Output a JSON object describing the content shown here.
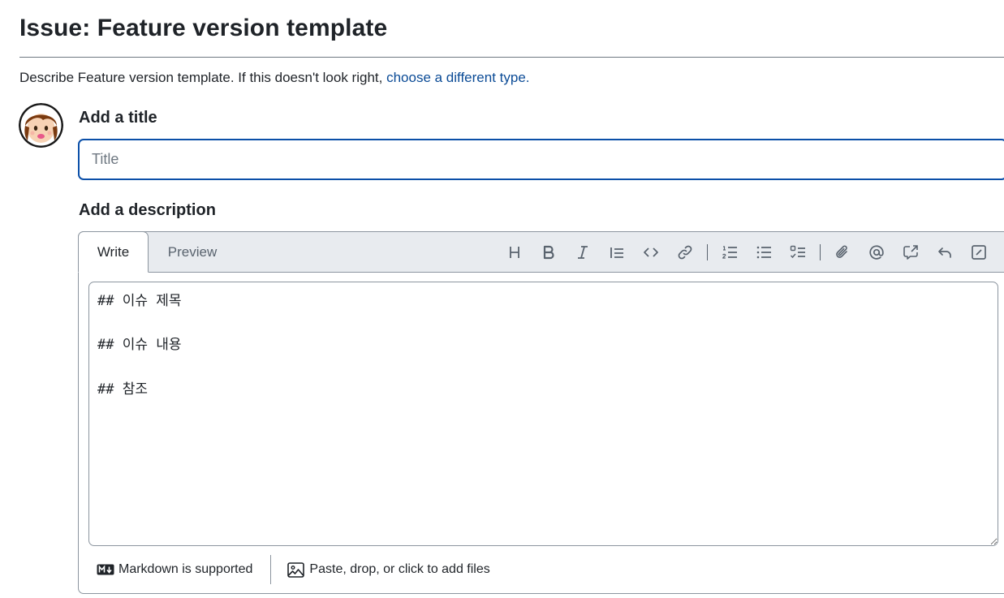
{
  "header": {
    "title": "Issue: Feature version template",
    "description_prefix": "Describe Feature version template. If this doesn't look right, ",
    "description_link": "choose a different type."
  },
  "title_field": {
    "label": "Add a title",
    "placeholder": "Title",
    "value": ""
  },
  "description_field": {
    "label": "Add a description",
    "tabs": [
      {
        "label": "Write",
        "active": true
      },
      {
        "label": "Preview",
        "active": false
      }
    ],
    "toolbar_icons": [
      "heading-icon",
      "bold-icon",
      "italic-icon",
      "quote-icon",
      "code-icon",
      "link-icon",
      "ordered-list-icon",
      "unordered-list-icon",
      "task-list-icon",
      "attach-icon",
      "mention-icon",
      "reference-icon",
      "undo-icon",
      "fullscreen-icon"
    ],
    "body": "## 이슈 제목\n\n## 이슈 내용\n\n## 참조",
    "footer": {
      "markdown_label": "Markdown is supported",
      "files_label": "Paste, drop, or click to add files"
    }
  },
  "colors": {
    "link": "#0b4b96",
    "focus_border": "#0b4fa8",
    "toolbar_bg": "#e8ebef",
    "border": "#8c959f"
  }
}
